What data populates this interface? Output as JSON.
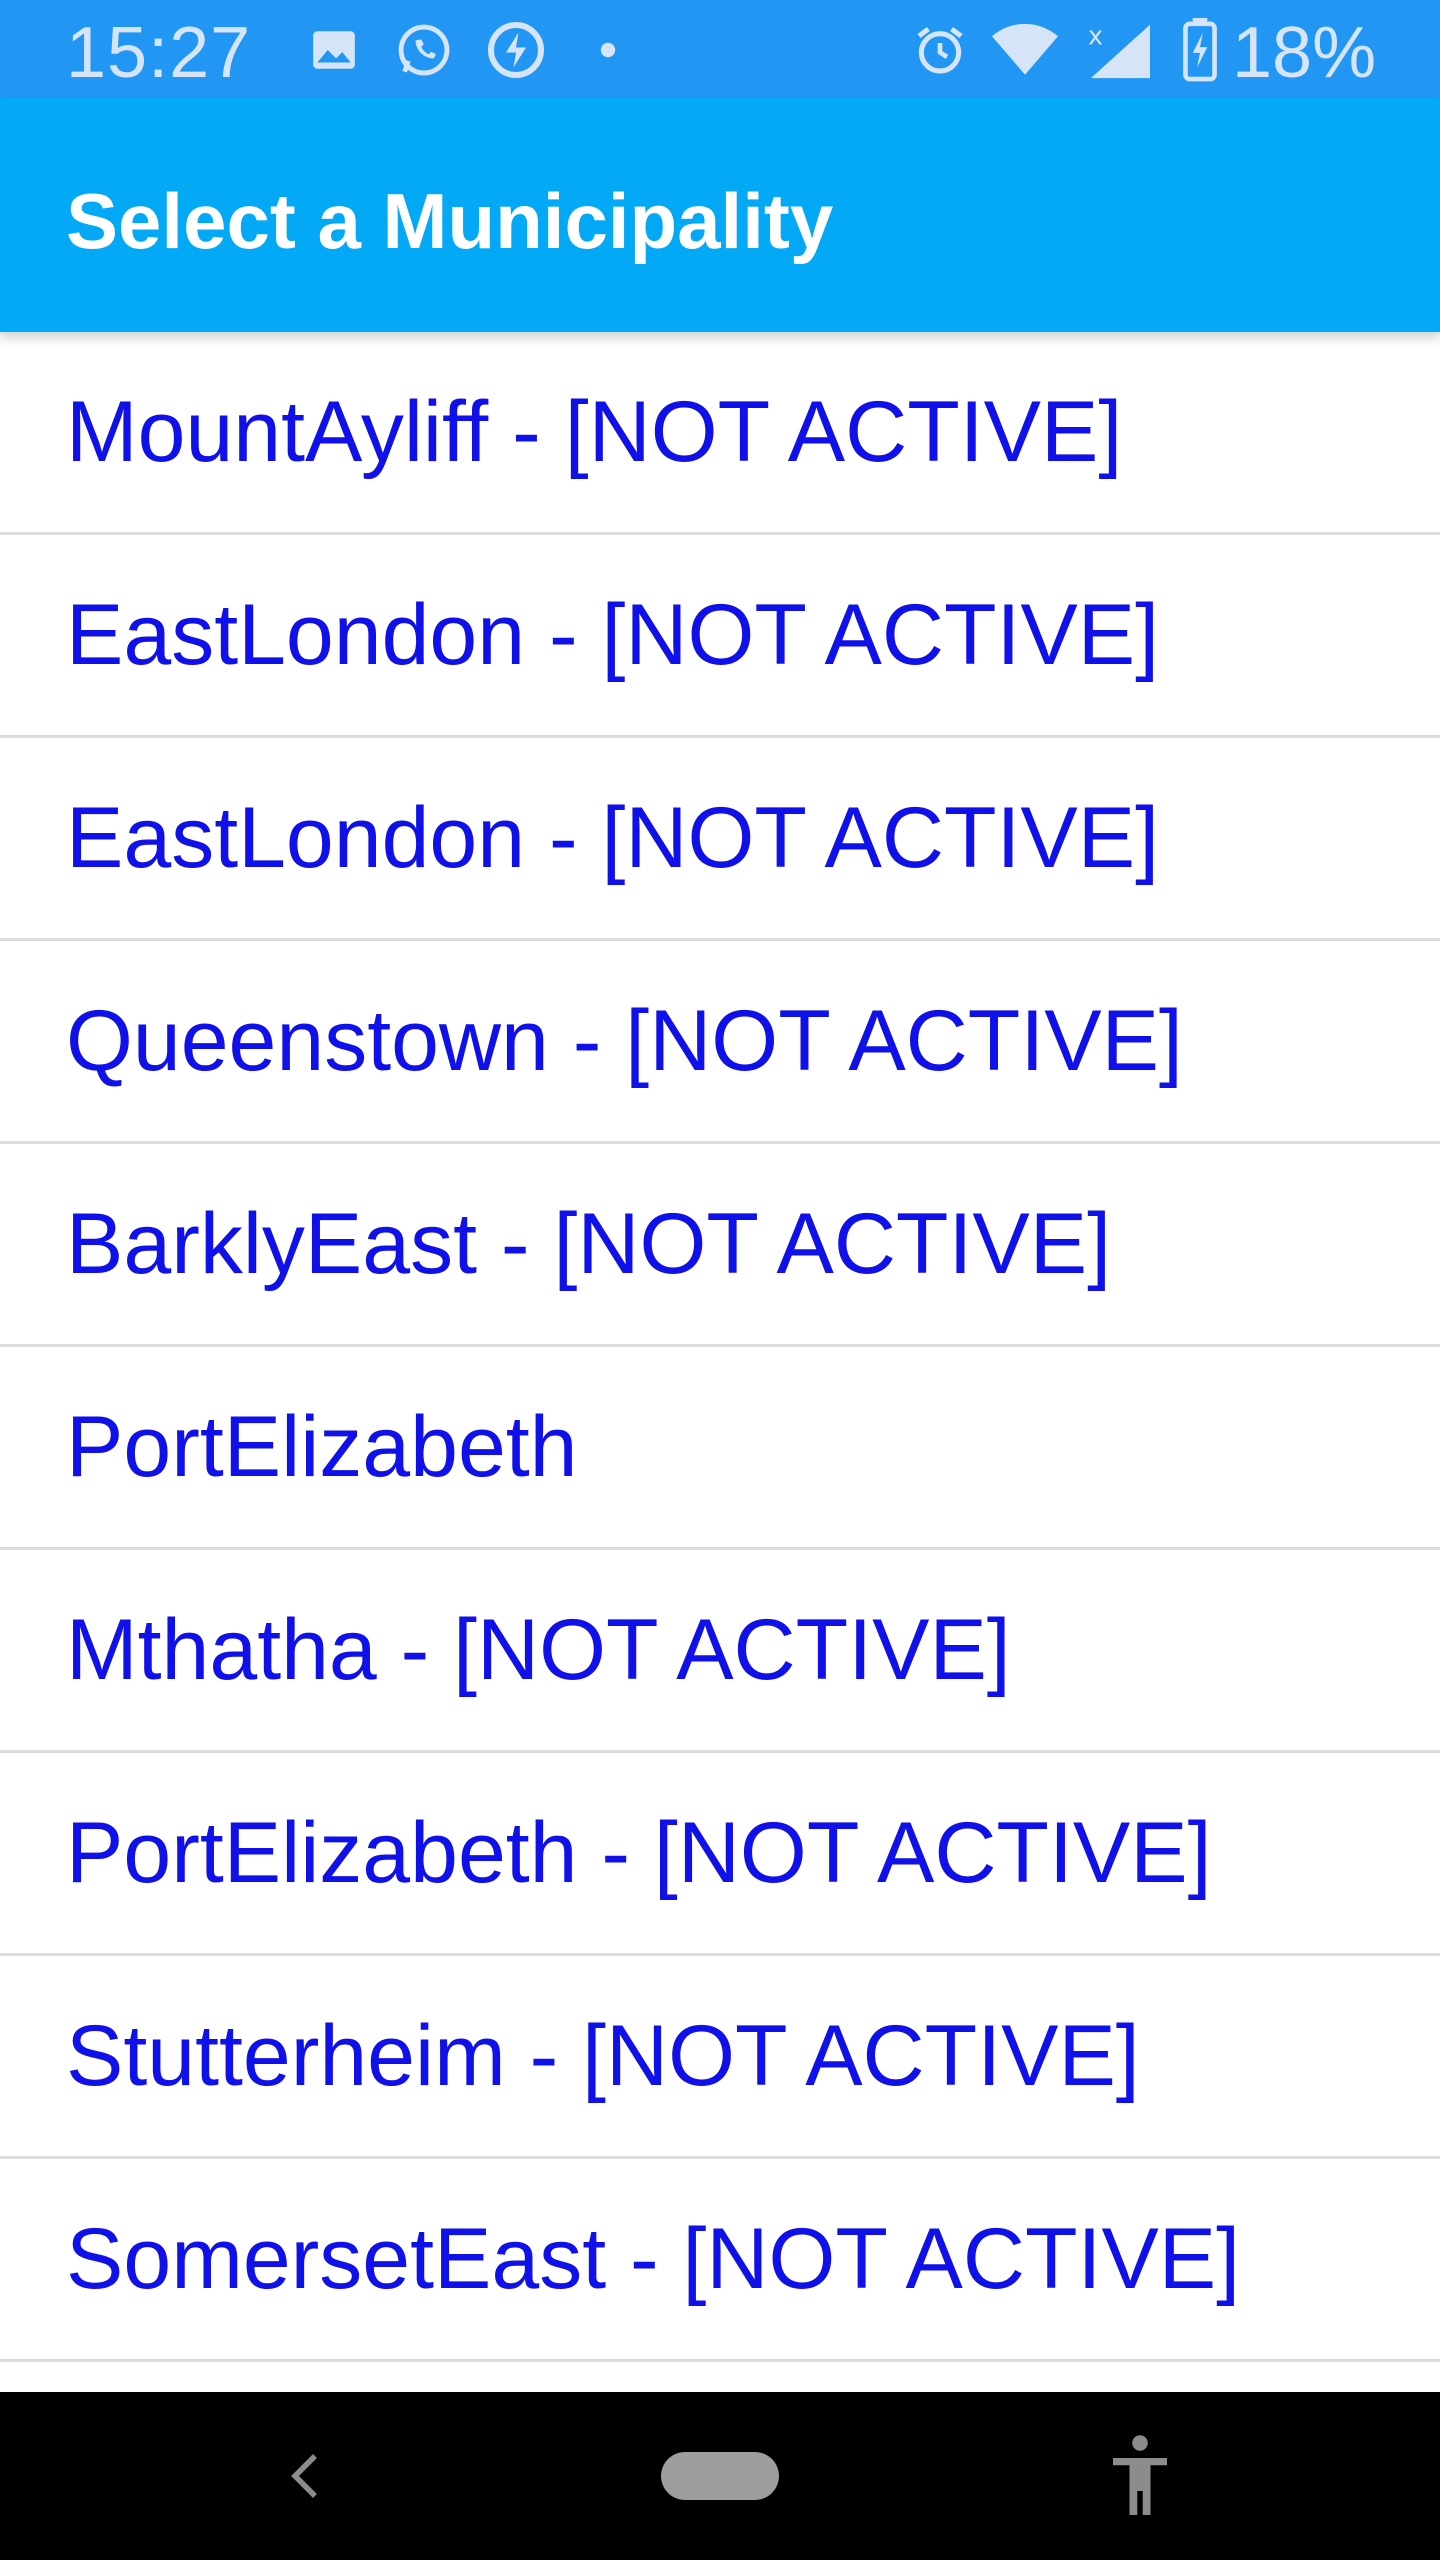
{
  "status_bar": {
    "time": "15:27",
    "battery_percent": "18%",
    "icons": [
      "image-icon",
      "whatsapp-icon",
      "power-saver-icon",
      "dot-icon",
      "alarm-icon",
      "wifi-icon",
      "signal-icon",
      "battery-charging-icon"
    ]
  },
  "app_bar": {
    "title": "Select a Municipality"
  },
  "municipalities": [
    {
      "label": "MountAyliff - [NOT ACTIVE]"
    },
    {
      "label": "EastLondon - [NOT ACTIVE]"
    },
    {
      "label": "EastLondon - [NOT ACTIVE]"
    },
    {
      "label": "Queenstown - [NOT ACTIVE]"
    },
    {
      "label": "BarklyEast - [NOT ACTIVE]"
    },
    {
      "label": "PortElizabeth"
    },
    {
      "label": "Mthatha - [NOT ACTIVE]"
    },
    {
      "label": "PortElizabeth - [NOT ACTIVE]"
    },
    {
      "label": "Stutterheim - [NOT ACTIVE]"
    },
    {
      "label": "SomersetEast - [NOT ACTIVE]"
    }
  ],
  "nav_bar": {
    "icons": [
      "back-icon",
      "home-pill-icon",
      "accessibility-icon"
    ]
  },
  "colors": {
    "status_bar": "#2196f3",
    "app_bar": "#03a9f4",
    "list_text": "#1010e8",
    "divider": "#dcdcdc"
  }
}
